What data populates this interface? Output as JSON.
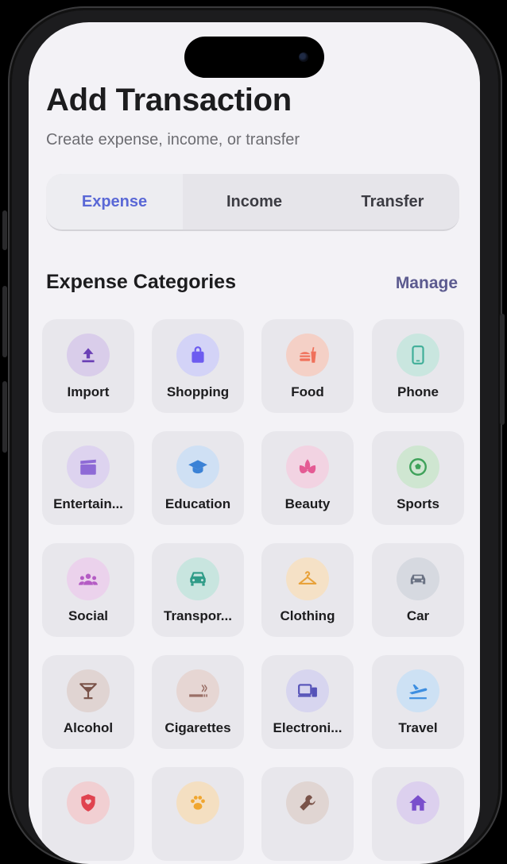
{
  "header": {
    "title": "Add Transaction",
    "subtitle": "Create expense, income, or transfer"
  },
  "tabs": [
    {
      "label": "Expense",
      "active": true
    },
    {
      "label": "Income",
      "active": false
    },
    {
      "label": "Transfer",
      "active": false
    }
  ],
  "section": {
    "title": "Expense Categories",
    "manage_label": "Manage"
  },
  "colors": {
    "accent": "#5a68d6",
    "manage": "#5b5a8f",
    "background": "#f3f2f6",
    "tile": "#e8e7ec"
  },
  "categories": [
    {
      "label": "Import",
      "icon": "upload-icon",
      "bg": "#d9cdea",
      "fg": "#6a3fb5"
    },
    {
      "label": "Shopping",
      "icon": "shopping-bag-icon",
      "bg": "#d3d3f7",
      "fg": "#6d5cf0"
    },
    {
      "label": "Food",
      "icon": "fast-food-icon",
      "bg": "#f4d0c6",
      "fg": "#f0705a"
    },
    {
      "label": "Phone",
      "icon": "smartphone-icon",
      "bg": "#c9e6df",
      "fg": "#3fae98"
    },
    {
      "label": "Entertain...",
      "icon": "clapperboard-icon",
      "bg": "#ddd3ef",
      "fg": "#8e6ad6"
    },
    {
      "label": "Education",
      "icon": "graduation-cap-icon",
      "bg": "#cfe0f4",
      "fg": "#3b82d6"
    },
    {
      "label": "Beauty",
      "icon": "lotus-icon",
      "bg": "#f2d3e2",
      "fg": "#e45b94"
    },
    {
      "label": "Sports",
      "icon": "soccer-ball-icon",
      "bg": "#cfe6d1",
      "fg": "#3fa25a"
    },
    {
      "label": "Social",
      "icon": "group-icon",
      "bg": "#ebd2ec",
      "fg": "#b45cc4"
    },
    {
      "label": "Transpor...",
      "icon": "car-front-icon",
      "bg": "#c8e5df",
      "fg": "#2f9c88"
    },
    {
      "label": "Clothing",
      "icon": "hanger-icon",
      "bg": "#f5e1c6",
      "fg": "#e8a23b"
    },
    {
      "label": "Car",
      "icon": "car-icon",
      "bg": "#d6d9e0",
      "fg": "#6b7384"
    },
    {
      "label": "Alcohol",
      "icon": "cocktail-icon",
      "bg": "#e0d4d2",
      "fg": "#7a5349"
    },
    {
      "label": "Cigarettes",
      "icon": "smoking-icon",
      "bg": "#e6d6d3",
      "fg": "#9a6f66"
    },
    {
      "label": "Electroni...",
      "icon": "devices-icon",
      "bg": "#d7d5ef",
      "fg": "#5552b8"
    },
    {
      "label": "Travel",
      "icon": "airplane-icon",
      "bg": "#cde1f4",
      "fg": "#3d8ee0"
    },
    {
      "label": "",
      "icon": "shield-icon",
      "bg": "#f1cfd2",
      "fg": "#e0434f"
    },
    {
      "label": "",
      "icon": "paw-icon",
      "bg": "#f4dfc1",
      "fg": "#f0a62f"
    },
    {
      "label": "",
      "icon": "wrench-icon",
      "bg": "#e0d5d2",
      "fg": "#7a5349"
    },
    {
      "label": "",
      "icon": "home-icon",
      "bg": "#dcd0ee",
      "fg": "#7a4fcc"
    }
  ]
}
